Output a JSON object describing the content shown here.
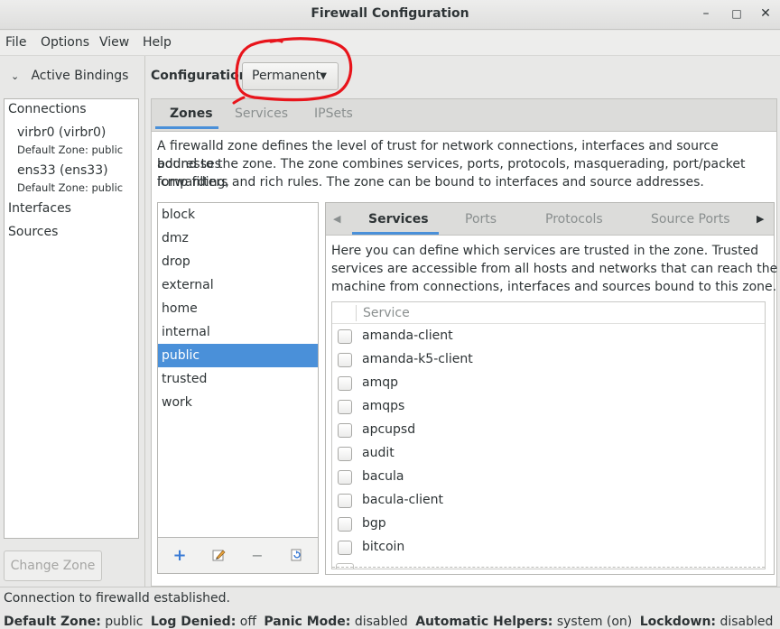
{
  "window": {
    "title": "Firewall Configuration",
    "minimize": "–",
    "maximize": "□",
    "close": "✕"
  },
  "menu": {
    "file": "File",
    "options": "Options",
    "view": "View",
    "help": "Help"
  },
  "bindings": {
    "toggle_label": "Active Bindings",
    "connections_header": "Connections",
    "connections": [
      {
        "name": "virbr0 (virbr0)",
        "zone": "Default Zone: public"
      },
      {
        "name": "ens33 (ens33)",
        "zone": "Default Zone: public"
      }
    ],
    "interfaces_header": "Interfaces",
    "sources_header": "Sources",
    "change_zone": "Change Zone"
  },
  "config": {
    "label": "Configuration:",
    "value": "Permanent"
  },
  "outer_tabs": [
    "Zones",
    "Services",
    "IPSets"
  ],
  "zones_description": [
    "A firewalld zone defines the level of trust for network connections, interfaces and source addresses",
    "bound to the zone. The zone combines services, ports, protocols, masquerading, port/packet forwarding,",
    "icmp filters and rich rules. The zone can be bound to interfaces and source addresses."
  ],
  "zones": [
    "block",
    "dmz",
    "drop",
    "external",
    "home",
    "internal",
    "public",
    "trusted",
    "work"
  ],
  "selected_zone": "public",
  "inner_tabs": [
    "Services",
    "Ports",
    "Protocols",
    "Source Ports"
  ],
  "services_description": [
    "Here you can define which services are trusted in the zone. Trusted",
    "services are accessible from all hosts and networks that can reach the",
    "machine from connections, interfaces and sources bound to this zone."
  ],
  "service_column": "Service",
  "services": [
    "amanda-client",
    "amanda-k5-client",
    "amqp",
    "amqps",
    "apcupsd",
    "audit",
    "bacula",
    "bacula-client",
    "bgp",
    "bitcoin"
  ],
  "status": {
    "message": "Connection to firewalld established.",
    "default_zone_label": "Default Zone:",
    "default_zone_value": "public",
    "log_denied_label": "Log Denied:",
    "log_denied_value": "off",
    "panic_mode_label": "Panic Mode:",
    "panic_mode_value": "disabled",
    "helpers_label": "Automatic Helpers:",
    "helpers_value": "system (on)",
    "lockdown_label": "Lockdown:",
    "lockdown_value": "disabled"
  },
  "colors": {
    "accent": "#4a90d9",
    "annotation": "#e8141b"
  }
}
